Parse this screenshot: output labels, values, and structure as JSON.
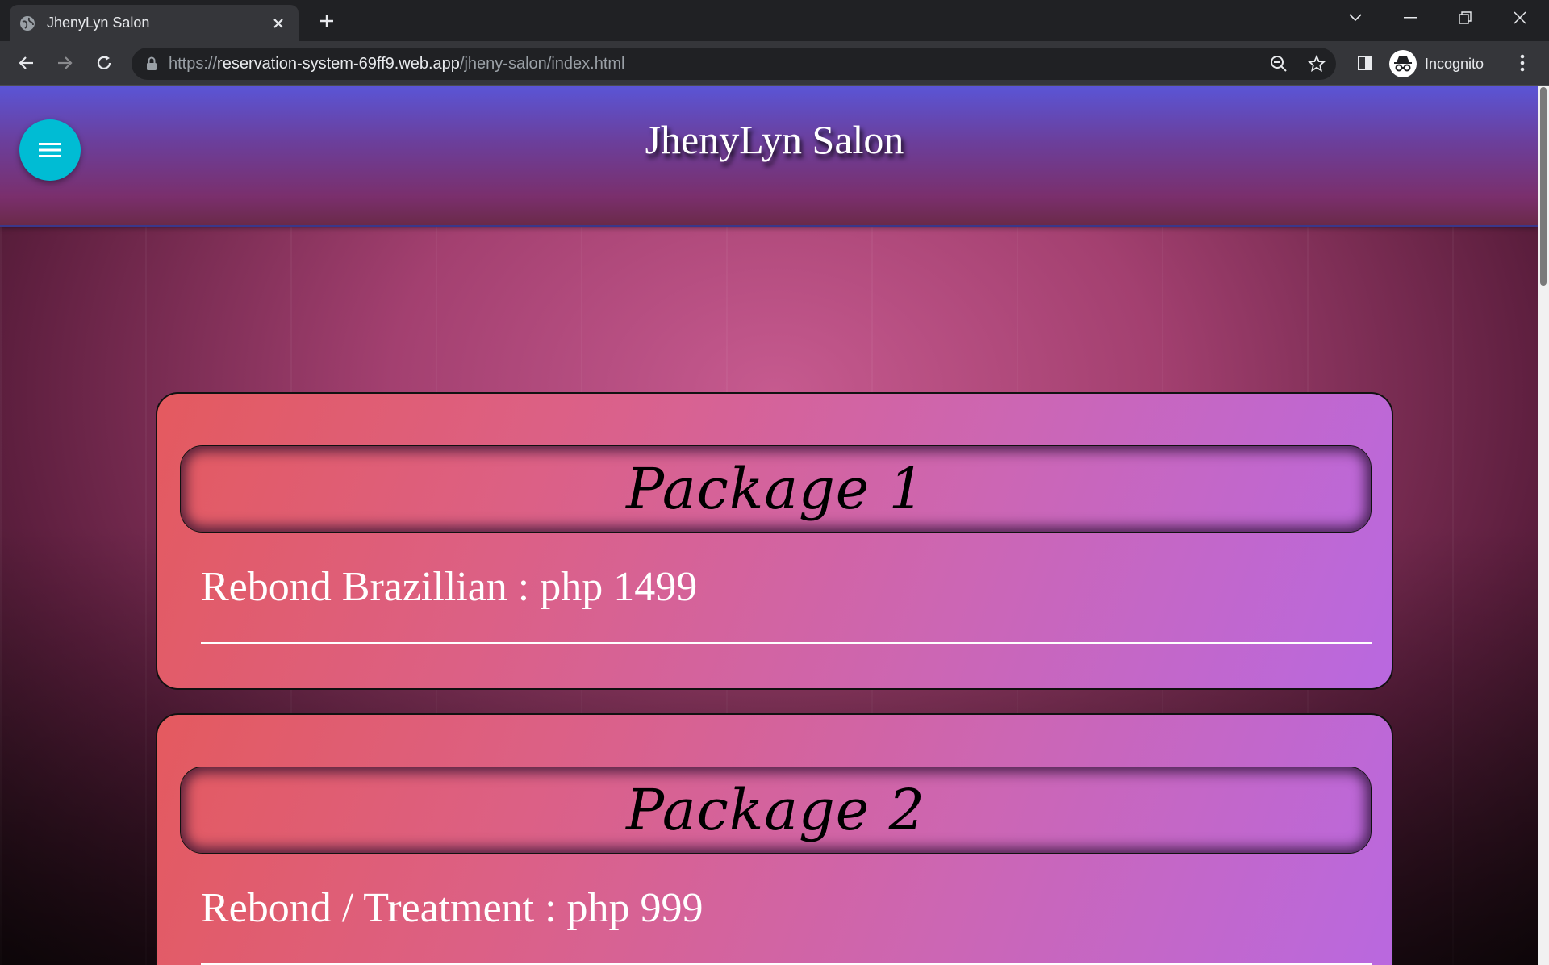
{
  "browser": {
    "tab_title": "JhenyLyn Salon",
    "url_scheme": "https://",
    "url_host": "reservation-system-69ff9.web.app",
    "url_path": "/jheny-salon/index.html",
    "profile_label": "Incognito"
  },
  "header": {
    "title": "JhenyLyn Salon",
    "menu_button_color": "#00bcd4"
  },
  "packages": [
    {
      "title": "Package 1",
      "item": "Rebond Brazillian : php 1499"
    },
    {
      "title": "Package 2",
      "item": "Rebond / Treatment : php 999"
    }
  ]
}
